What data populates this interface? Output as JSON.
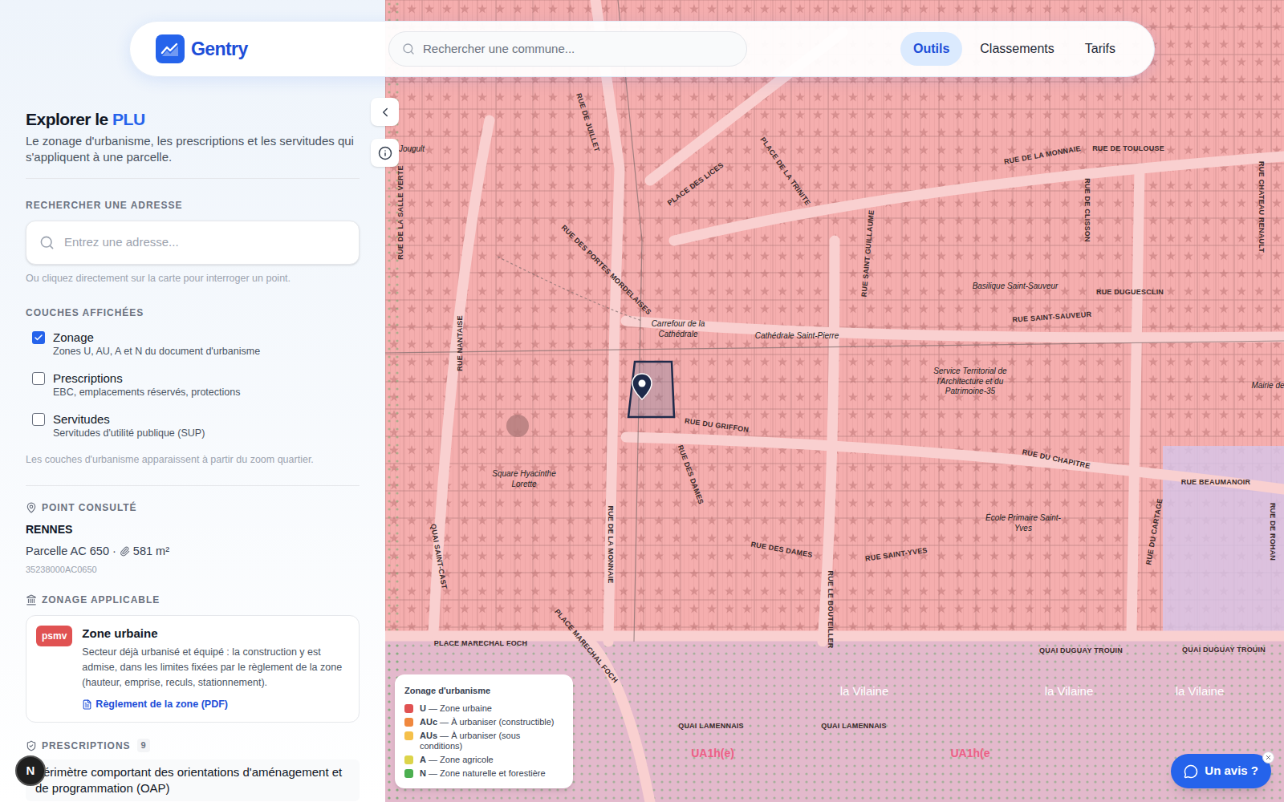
{
  "header": {
    "logo": "Gentry",
    "search_placeholder": "Rechercher une commune...",
    "nav": [
      {
        "label": "Outils",
        "selected": true
      },
      {
        "label": "Classements",
        "selected": false
      },
      {
        "label": "Tarifs",
        "selected": false
      }
    ]
  },
  "panel": {
    "title_prefix": "Explorer le",
    "title_highlight": "PLU",
    "subtitle": "Le zonage d'urbanisme, les prescriptions et les servitudes qui s'appliquent à une parcelle.",
    "address_label": "RECHERCHER UNE ADRESSE",
    "address_placeholder": "Entrez une adresse...",
    "address_hint": "Ou cliquez directement sur la carte pour interroger un point.",
    "layers_label": "COUCHES AFFICHÉES",
    "layers": [
      {
        "name": "Zonage",
        "description": "Zones U, AU, A et N du document d'urbanisme",
        "checked": true
      },
      {
        "name": "Prescriptions",
        "description": "EBC, emplacements réservés, protections",
        "checked": false
      },
      {
        "name": "Servitudes",
        "description": "Servitudes d'utilité publique (SUP)",
        "checked": false
      }
    ],
    "layers_note": "Les couches d'urbanisme apparaissent à partir du zoom quartier.",
    "point": {
      "label": "POINT CONSULTÉ",
      "city": "RENNES",
      "parcel": "Parcelle AC 650",
      "separator": "·",
      "area": "581 m²",
      "id": "35238000AC0650"
    },
    "zoning": {
      "label": "ZONAGE APPLICABLE",
      "badge": "psmv",
      "title": "Zone urbaine",
      "description": "Secteur déjà urbanisé et équipé : la construction y est admise, dans les limites fixées par le règlement de la zone (hauteur, emprise, reculs, stationnement).",
      "link": "Règlement de la zone (PDF)"
    },
    "prescriptions": {
      "label": "PRESCRIPTIONS",
      "count": "9",
      "items": [
        "Périmètre comportant des orientations d'aménagement et de programmation (OAP)"
      ]
    }
  },
  "map": {
    "labels": [
      {
        "text": "Jougult",
        "kind": "place"
      },
      {
        "text": "RUE DE JUILLET",
        "kind": "street"
      },
      {
        "text": "PLACE DES LICES",
        "kind": "street"
      },
      {
        "text": "PLACE DE LA TRINITE",
        "kind": "street"
      },
      {
        "text": "RUE DE LA MONNAIE",
        "kind": "street"
      },
      {
        "text": "RUE DE TOULOUSE",
        "kind": "street"
      },
      {
        "text": "RUE DE CLISSON",
        "kind": "street"
      },
      {
        "text": "RUE CHATEAU RENAULT",
        "kind": "street"
      },
      {
        "text": "RUE DE LA SALLE VERTE",
        "kind": "street"
      },
      {
        "text": "RUE DES PORTES MORDELAISES",
        "kind": "street"
      },
      {
        "text": "RUE SAINT GUILLAUME",
        "kind": "street"
      },
      {
        "text": "Basilique Saint-Sauveur",
        "kind": "place"
      },
      {
        "text": "RUE DUGUESCLIN",
        "kind": "street"
      },
      {
        "text": "RUE SAINT-SAUVEUR",
        "kind": "street"
      },
      {
        "text": "Carrefour de la Cathédrale",
        "kind": "place"
      },
      {
        "text": "Cathédrale Saint-Pierre",
        "kind": "place"
      },
      {
        "text": "Service Territorial de l'Architecture et du Patrimoine-35",
        "kind": "place"
      },
      {
        "text": "Mairie de",
        "kind": "place"
      },
      {
        "text": "RUE NANTAISE",
        "kind": "street"
      },
      {
        "text": "RUE DU GRIFFON",
        "kind": "street"
      },
      {
        "text": "RUE DES DAMES",
        "kind": "street"
      },
      {
        "text": "RUE DES DAMES",
        "kind": "street"
      },
      {
        "text": "RUE DU CHAPITRE",
        "kind": "street"
      },
      {
        "text": "RUE BEAUMANOIR",
        "kind": "street"
      },
      {
        "text": "Square Hyacinthe Lorette",
        "kind": "place"
      },
      {
        "text": "École Primaire Saint-Yves",
        "kind": "place"
      },
      {
        "text": "RUE DE LA MONNAIE",
        "kind": "street"
      },
      {
        "text": "RUE SAINT-YVES",
        "kind": "street"
      },
      {
        "text": "RUE LE BOUTEILLER",
        "kind": "street"
      },
      {
        "text": "RUE DU CARTAGE",
        "kind": "street"
      },
      {
        "text": "RUE DE ROHAN",
        "kind": "street"
      },
      {
        "text": "QUAI SAINT-CAST",
        "kind": "street"
      },
      {
        "text": "PLACE MARECHAL FOCH",
        "kind": "street"
      },
      {
        "text": "PLACE MARECHAL FOCH",
        "kind": "street"
      },
      {
        "text": "QUAI DUGUAY TROUIN",
        "kind": "street"
      },
      {
        "text": "QUAI DUGUAY TROUIN",
        "kind": "street"
      },
      {
        "text": "la Vilaine",
        "kind": "water"
      },
      {
        "text": "la Vilaine",
        "kind": "water"
      },
      {
        "text": "la Vilaine",
        "kind": "water"
      },
      {
        "text": "QUAI LAMENNAIS",
        "kind": "street"
      },
      {
        "text": "QUAI LAMENNAIS",
        "kind": "street"
      },
      {
        "text": "UA1h(e)",
        "kind": "zone"
      },
      {
        "text": "UA1h(e",
        "kind": "zone"
      }
    ],
    "legend": {
      "title": "Zonage d'urbanisme",
      "items": [
        {
          "code": "U",
          "label": "— Zone urbaine",
          "color": "#e05252"
        },
        {
          "code": "AUc",
          "label": "— À urbaniser (constructible)",
          "color": "#f0883e"
        },
        {
          "code": "AUs",
          "label": "— À urbaniser (sous conditions)",
          "color": "#f5c04a"
        },
        {
          "code": "A",
          "label": "— Zone agricole",
          "color": "#dcd44a"
        },
        {
          "code": "N",
          "label": "— Zone naturelle et forestière",
          "color": "#4caf50"
        }
      ]
    }
  },
  "feedback": {
    "label": "Un avis ?"
  },
  "avatar": "N"
}
